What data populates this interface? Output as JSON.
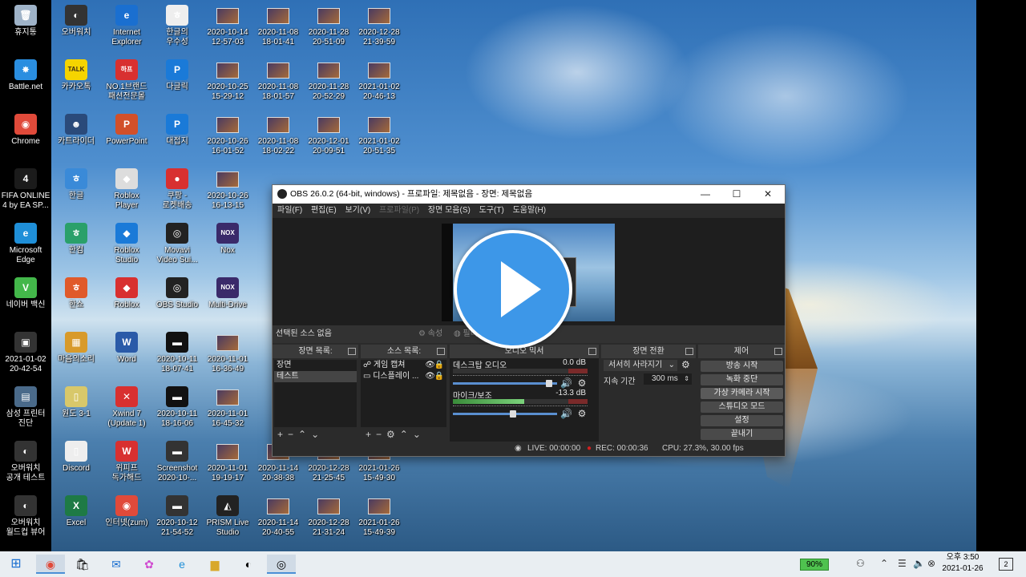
{
  "desktop_left": [
    {
      "label": "휴지통",
      "glyph": "🗑",
      "color": "#9fb3c8"
    },
    {
      "label": "Battle.net",
      "glyph": "✸",
      "color": "#2a8ee0"
    },
    {
      "label": "Chrome",
      "glyph": "◉",
      "color": "#e04a3a"
    },
    {
      "label": "FIFA ONLINE\n4 by EA SP...",
      "glyph": "4",
      "color": "#1b1b1b"
    },
    {
      "label": "Microsoft\nEdge",
      "glyph": "e",
      "color": "#1f8fd8"
    },
    {
      "label": "네이버 백신",
      "glyph": "V",
      "color": "#43b74a"
    },
    {
      "label": "2021-01-02\n20-42-54",
      "glyph": "▣",
      "color": "#333"
    },
    {
      "label": "삼성 프린터\n진단",
      "glyph": "▤",
      "color": "#4a6a8a"
    },
    {
      "label": "오버워치\n공개 테스트",
      "glyph": "◐",
      "color": "#333"
    },
    {
      "label": "오버워치\n월드컵 뷰어",
      "glyph": "◐",
      "color": "#333"
    }
  ],
  "desktop_col1": [
    {
      "label": "오버워치",
      "glyph": "◐",
      "color": "#333"
    },
    {
      "label": "카카오톡",
      "glyph": "TALK",
      "color": "#f5d400"
    },
    {
      "label": "카트라이더",
      "glyph": "☻",
      "color": "#2a4a7a"
    },
    {
      "label": "한글",
      "glyph": "ㅎ",
      "color": "#3a8ad8"
    },
    {
      "label": "한컴",
      "glyph": "ㅎ",
      "color": "#2aa06a"
    },
    {
      "label": "한쇼",
      "glyph": "ㅎ",
      "color": "#e05a2a"
    },
    {
      "label": "마음의소리",
      "glyph": "▦",
      "color": "#d89a2a"
    },
    {
      "label": "원도 3-1",
      "glyph": "▯",
      "color": "#d8c86a"
    },
    {
      "label": "Discord",
      "glyph": "▯",
      "color": "#eee"
    },
    {
      "label": "Excel",
      "glyph": "X",
      "color": "#1e7a45"
    }
  ],
  "desktop_col2": [
    {
      "label": "Internet\nExplorer",
      "glyph": "e",
      "color": "#1a6fd0"
    },
    {
      "label": "NO.1브랜드\n패션전문몰",
      "glyph": "하프",
      "color": "#d83030"
    },
    {
      "label": "PowerPoint",
      "glyph": "P",
      "color": "#d2502a"
    },
    {
      "label": "Roblox\nPlayer",
      "glyph": "◆",
      "color": "#ddd"
    },
    {
      "label": "Roblox\nStudio",
      "glyph": "◆",
      "color": "#1a7ad8"
    },
    {
      "label": "Roblox",
      "glyph": "◆",
      "color": "#d83030"
    },
    {
      "label": "Word",
      "glyph": "W",
      "color": "#2a5aa8"
    },
    {
      "label": "Xwind 7\n(Update 1)",
      "glyph": "✕",
      "color": "#d83030"
    },
    {
      "label": "위피프\n독가해드",
      "glyph": "W",
      "color": "#d83030"
    },
    {
      "label": "인터넷(zum)",
      "glyph": "◉",
      "color": "#e04a3a"
    }
  ],
  "desktop_col3": [
    {
      "label": "한글의\n우수성",
      "glyph": "ㅎ",
      "color": "#eee"
    },
    {
      "label": "다글릭",
      "glyph": "P",
      "color": "#1a7ad8"
    },
    {
      "label": "대접지",
      "glyph": "P",
      "color": "#1a7ad8"
    },
    {
      "label": "쿠팡 -\n로켓배송",
      "glyph": "●",
      "color": "#d83030"
    },
    {
      "label": "Movavi\nVideo Sui...",
      "glyph": "◎",
      "color": "#222"
    },
    {
      "label": "OBS Studio",
      "glyph": "◎",
      "color": "#222"
    },
    {
      "label": "2020-10-11\n18-07-41",
      "glyph": "▬",
      "color": "#111"
    },
    {
      "label": "2020-10-11\n18-16-06",
      "glyph": "▬",
      "color": "#111"
    },
    {
      "label": "Screenshot\n2020-10-...",
      "glyph": "▬",
      "color": "#333"
    },
    {
      "label": "2020-10-12\n21-54-52",
      "glyph": "▬",
      "color": "#333"
    }
  ],
  "desktop_col4": [
    {
      "label": "2020-10-14\n12-57-03"
    },
    {
      "label": "2020-10-25\n15-29-12"
    },
    {
      "label": "2020-10-26\n16-01-52"
    },
    {
      "label": "2020-10-26\n16-13-15"
    },
    {
      "label": "Nox",
      "glyph": "NOX",
      "color": "#3a2a6a"
    },
    {
      "label": "Multi-Drive",
      "glyph": "NOX",
      "color": "#3a2a6a"
    },
    {
      "label": "2020-11-01\n16-36-49"
    },
    {
      "label": "2020-11-01\n16-45-32"
    },
    {
      "label": "2020-11-01\n19-19-17"
    },
    {
      "label": "PRISM Live\nStudio",
      "glyph": "◭",
      "color": "#222"
    }
  ],
  "desktop_col5": [
    {
      "label": "2020-11-08\n18-01-41"
    },
    {
      "label": "2020-11-08\n18-01-57"
    },
    {
      "label": "2020-11-08\n18-02-22"
    },
    {
      "label": "2020-11-14\n20-38-38"
    },
    {
      "label": "2020-11-14\n20-40-55"
    }
  ],
  "desktop_col6": [
    {
      "label": "2020-11-28\n20-51-09"
    },
    {
      "label": "2020-11-28\n20-52-29"
    },
    {
      "label": "2020-12-01\n20-09-51"
    },
    {
      "label": "2020-12-28\n21-25-45"
    },
    {
      "label": "2020-12-28\n21-31-24"
    }
  ],
  "desktop_col7": [
    {
      "label": "2020-12-28\n21-39-59"
    },
    {
      "label": "2021-01-02\n20-46-13"
    },
    {
      "label": "2021-01-02\n20-51-35"
    },
    {
      "label": "2021-01-26\n15-49-30"
    },
    {
      "label": "2021-01-26\n15-49-39"
    }
  ],
  "obs": {
    "title": "OBS 26.0.2 (64-bit, windows) - 프로파일: 제목없음 - 장면: 제목없음",
    "menu": [
      "파일(F)",
      "편집(E)",
      "보기(V)",
      "프로파일(P)",
      "장면 모음(S)",
      "도구(T)",
      "도움말(H)"
    ],
    "no_source": "선택된 소스 없음",
    "source_props": "속성",
    "source_filters": "필터",
    "docks": {
      "scenes": "장면 목록",
      "sources": "소스 목록",
      "mixer": "오디오 믹서",
      "transitions": "장면 전환",
      "controls": "제어"
    },
    "scenes": [
      "장면",
      "테스트"
    ],
    "sources": [
      "게임 캡쳐",
      "디스플레이 ..."
    ],
    "mixer": [
      {
        "name": "데스크탑 오디오",
        "db": "0.0 dB",
        "level": 0.0,
        "volume": 0.95
      },
      {
        "name": "마이크/보조",
        "db": "-13.3 dB",
        "level": 0.62,
        "volume": 0.58
      }
    ],
    "transition": {
      "type": "서서히 사라지기",
      "duration_label": "지속 기간",
      "duration": "300 ms"
    },
    "controls": [
      "방송 시작",
      "녹화 중단",
      "가상 카메라 시작",
      "스튜디오 모드",
      "설정",
      "끝내기"
    ],
    "status": {
      "live": "LIVE: 00:00:00",
      "rec": "REC: 00:00:36",
      "cpu": "CPU: 27.3%, 30.00 fps"
    }
  },
  "taskbar": {
    "battery": "90%",
    "time": "오후 3:50",
    "date": "2021-01-26",
    "notif": "2"
  }
}
